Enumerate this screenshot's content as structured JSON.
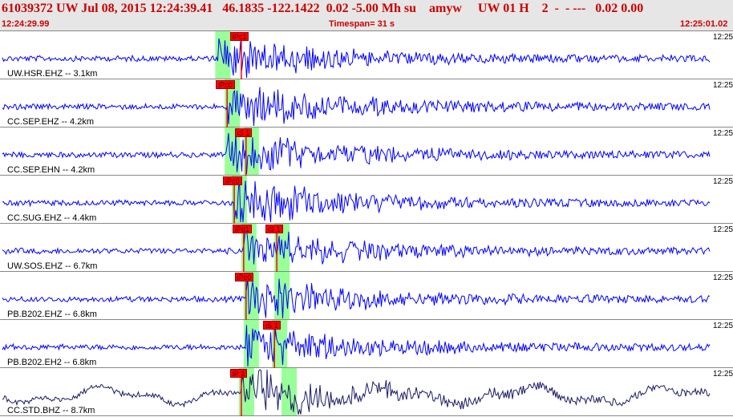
{
  "header": {
    "title": "61039372 UW Jul 08, 2015 12:24:39.41   46.1835 -122.1422  0.02 -5.00 Mh su    amyw     UW 01 H    2  -  - ---   0.02 0.00",
    "start_time": "12:24:29.99",
    "timespan": "Timespan=  31 s",
    "end_time": "12:25:01.02"
  },
  "colors": {
    "trace": "#0000ff",
    "trace_dark": "#1a1a66",
    "pick": "#ff0000",
    "window": "#99ff99",
    "title": "#cc0000"
  },
  "channels": [
    {
      "label": "UW.HSR.EHZ -- 3.1km",
      "time": "12:25",
      "picks": [
        {
          "label": "iPc1",
          "t": 10.2
        }
      ],
      "windows": [
        9.2
      ]
    },
    {
      "label": "CC.SEP.EHZ -- 4.2km",
      "time": "12:25",
      "picks": [
        {
          "label": "iPc0",
          "t": 9.6
        }
      ],
      "windows": [
        9.6
      ]
    },
    {
      "label": "CC.SEP.EHN -- 4.2km",
      "time": "12:25",
      "picks": [
        {
          "label": "iS 1",
          "t": 10.4
        }
      ],
      "windows": [
        9.6,
        10.4
      ]
    },
    {
      "label": "CC.SUG.EHZ -- 4.4km",
      "time": "12:25",
      "picks": [
        {
          "label": "iPc0",
          "t": 9.9
        }
      ],
      "windows": [
        9.9
      ]
    },
    {
      "label": "UW.SOS.EHZ -- 6.7km",
      "time": "12:25",
      "picks": [
        {
          "label": "iPd1",
          "t": 10.3
        },
        {
          "label": "iS 1",
          "t": 11.7
        }
      ],
      "windows": [
        10.3,
        11.7
      ]
    },
    {
      "label": "PB.B202.EHZ -- 6.8km",
      "time": "12:25",
      "picks": [
        {
          "label": "iPc0",
          "t": 10.4
        }
      ],
      "windows": [
        10.4,
        11.7
      ]
    },
    {
      "label": "PB.B202.EH2 -- 6.8km",
      "time": "12:25",
      "picks": [
        {
          "label": "iS 1",
          "t": 11.6
        }
      ],
      "windows": [
        10.4,
        11.6
      ]
    },
    {
      "label": "CC.STD.BHZ -- 8.7km",
      "time": "12:25",
      "picks": [
        {
          "label": "iP 1",
          "t": 10.2
        }
      ],
      "windows": [
        10.2,
        12.0
      ]
    }
  ]
}
